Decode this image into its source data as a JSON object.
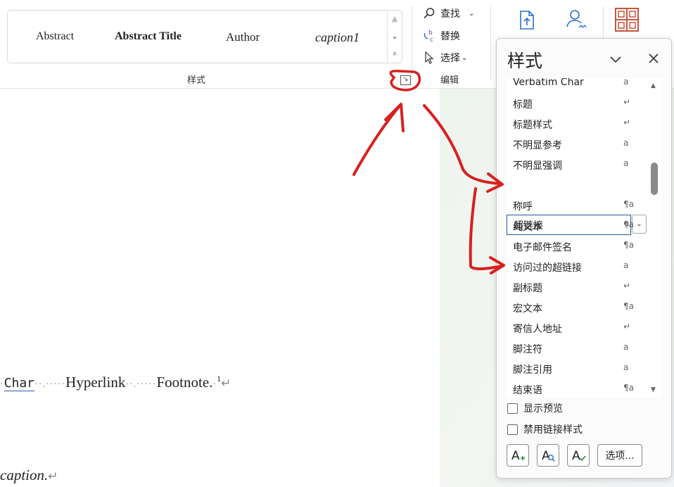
{
  "ribbon": {
    "style_gallery": [
      "Abstract",
      "Abstract Title",
      "Author",
      "caption1"
    ],
    "styles_group_label": "样式",
    "editing": {
      "find": "查找",
      "replace": "替换",
      "select": "选择",
      "group_label": "编辑"
    }
  },
  "document": {
    "line1": {
      "char": "Char",
      "hyperlink": "Hyperlink",
      "footnote": "Footnote.",
      "footnote_ref": "1"
    },
    "line2": {
      "caption": "caption."
    }
  },
  "styles_pane": {
    "title": "样式",
    "items": [
      {
        "name": "Verbatim Char",
        "type": "a"
      },
      {
        "name": "标题",
        "type": "↵"
      },
      {
        "name": "标题样式",
        "type": "↵"
      },
      {
        "name": "不明显参考",
        "type": "a"
      },
      {
        "name": "不明显强调",
        "type": "a"
      },
      {
        "name": "超链接",
        "type": "a",
        "selected": true
      },
      {
        "name": "称呼",
        "type": "¶a"
      },
      {
        "name": "纯文本",
        "type": "¶a"
      },
      {
        "name": "电子邮件签名",
        "type": "¶a"
      },
      {
        "name": "访问过的超链接",
        "type": "a"
      },
      {
        "name": "副标题",
        "type": "↵"
      },
      {
        "name": "宏文本",
        "type": "¶a"
      },
      {
        "name": "寄信人地址",
        "type": "↵"
      },
      {
        "name": "脚注符",
        "type": "a"
      },
      {
        "name": "脚注引用",
        "type": "a"
      },
      {
        "name": "结束语",
        "type": "¶a"
      }
    ],
    "show_preview": "显示预览",
    "disable_linked_styles": "禁用链接样式",
    "options_button": "选项..."
  },
  "colors": {
    "annotation_red": "#d8201f",
    "selection_border": "#2b5797",
    "hyperlink_underline": "#2f5aa0",
    "accent_orange": "#c8553d"
  }
}
